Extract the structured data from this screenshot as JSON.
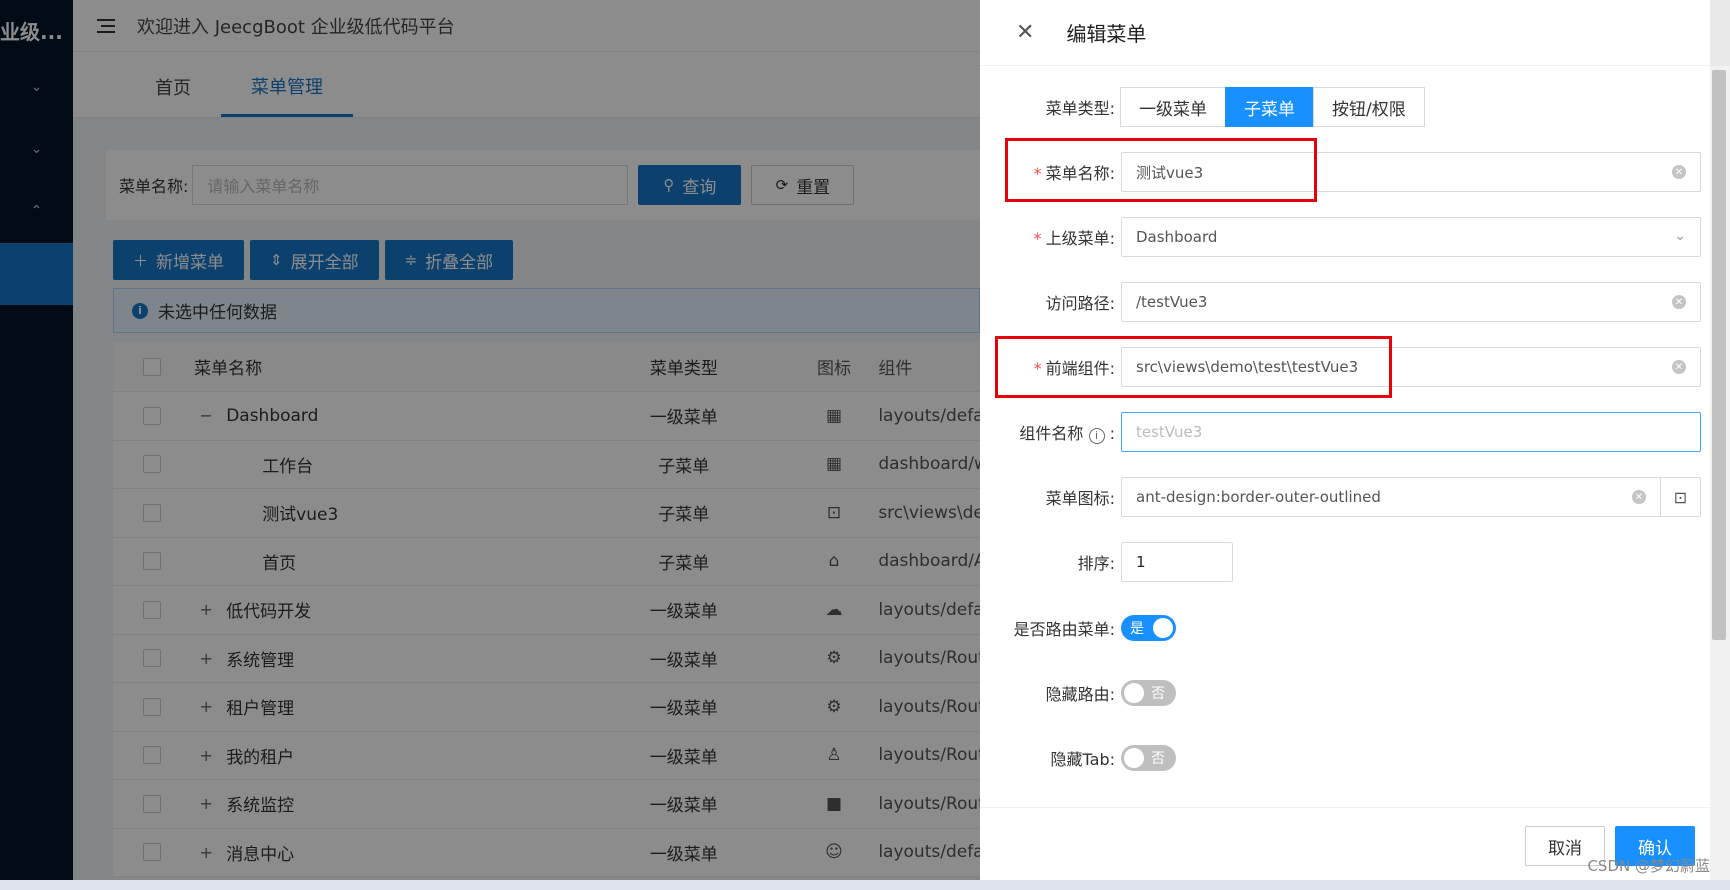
{
  "sidebar": {
    "brand": "业级..."
  },
  "header": {
    "welcome": "欢迎进入 JeecgBoot 企业级低代码平台"
  },
  "tabs": [
    {
      "label": "首页"
    },
    {
      "label": "菜单管理"
    }
  ],
  "search": {
    "label": "菜单名称:",
    "placeholder": "请输入菜单名称",
    "query_label": "查询",
    "reset_label": "重置"
  },
  "toolbar": {
    "add_label": "新增菜单",
    "expand_label": "展开全部",
    "collapse_label": "折叠全部"
  },
  "alert": {
    "text": "未选中任何数据"
  },
  "table": {
    "columns": [
      "菜单名称",
      "菜单类型",
      "图标",
      "组件"
    ],
    "rows": [
      {
        "expander": "−",
        "name": "Dashboard",
        "type": "一级菜单",
        "icon": "▦",
        "component": "layouts/defa",
        "indent": false
      },
      {
        "expander": "",
        "name": "工作台",
        "type": "子菜单",
        "icon": "▦",
        "component": "dashboard/w",
        "indent": true
      },
      {
        "expander": "",
        "name": "测试vue3",
        "type": "子菜单",
        "icon": "⊡",
        "component": "src\\views\\de",
        "indent": true
      },
      {
        "expander": "",
        "name": "首页",
        "type": "子菜单",
        "icon": "⌂",
        "component": "dashboard/A",
        "indent": true
      },
      {
        "expander": "+",
        "name": "低代码开发",
        "type": "一级菜单",
        "icon": "☁",
        "component": "layouts/defa",
        "indent": false
      },
      {
        "expander": "+",
        "name": "系统管理",
        "type": "一级菜单",
        "icon": "⚙",
        "component": "layouts/Rout",
        "indent": false
      },
      {
        "expander": "+",
        "name": "租户管理",
        "type": "一级菜单",
        "icon": "⚙",
        "component": "layouts/Rout",
        "indent": false
      },
      {
        "expander": "+",
        "name": "我的租户",
        "type": "一级菜单",
        "icon": "♙",
        "component": "layouts/Rout",
        "indent": false
      },
      {
        "expander": "+",
        "name": "系统监控",
        "type": "一级菜单",
        "icon": "■",
        "component": "layouts/Rout",
        "indent": false
      },
      {
        "expander": "+",
        "name": "消息中心",
        "type": "一级菜单",
        "icon": "☺",
        "component": "layouts/defa",
        "indent": false
      }
    ]
  },
  "drawer": {
    "title": "编辑菜单",
    "menu_type": {
      "label": "菜单类型:",
      "options": [
        "一级菜单",
        "子菜单",
        "按钮/权限"
      ],
      "selected": "子菜单"
    },
    "menu_name": {
      "label": "菜单名称:",
      "value": "测试vue3"
    },
    "parent_menu": {
      "label": "上级菜单:",
      "value": "Dashboard"
    },
    "path": {
      "label": "访问路径:",
      "value": "/testVue3"
    },
    "component": {
      "label": "前端组件:",
      "value": "src\\views\\demo\\test\\testVue3"
    },
    "component_name": {
      "label": "组件名称",
      "colon": ":",
      "placeholder": "testVue3"
    },
    "icon": {
      "label": "菜单图标:",
      "value": "ant-design:border-outer-outlined"
    },
    "sort": {
      "label": "排序:",
      "value": "1"
    },
    "is_route": {
      "label": "是否路由菜单:",
      "value": "是"
    },
    "hide_route": {
      "label": "隐藏路由:",
      "value": "否"
    },
    "hide_tab": {
      "label": "隐藏Tab:",
      "value": "否"
    },
    "cancel_label": "取消",
    "confirm_label": "确认"
  },
  "watermark": "CSDN @梦幻蔚蓝",
  "colors": {
    "primary": "#1890ff",
    "sidebar": "#001529",
    "highlight": "#e8000b"
  }
}
